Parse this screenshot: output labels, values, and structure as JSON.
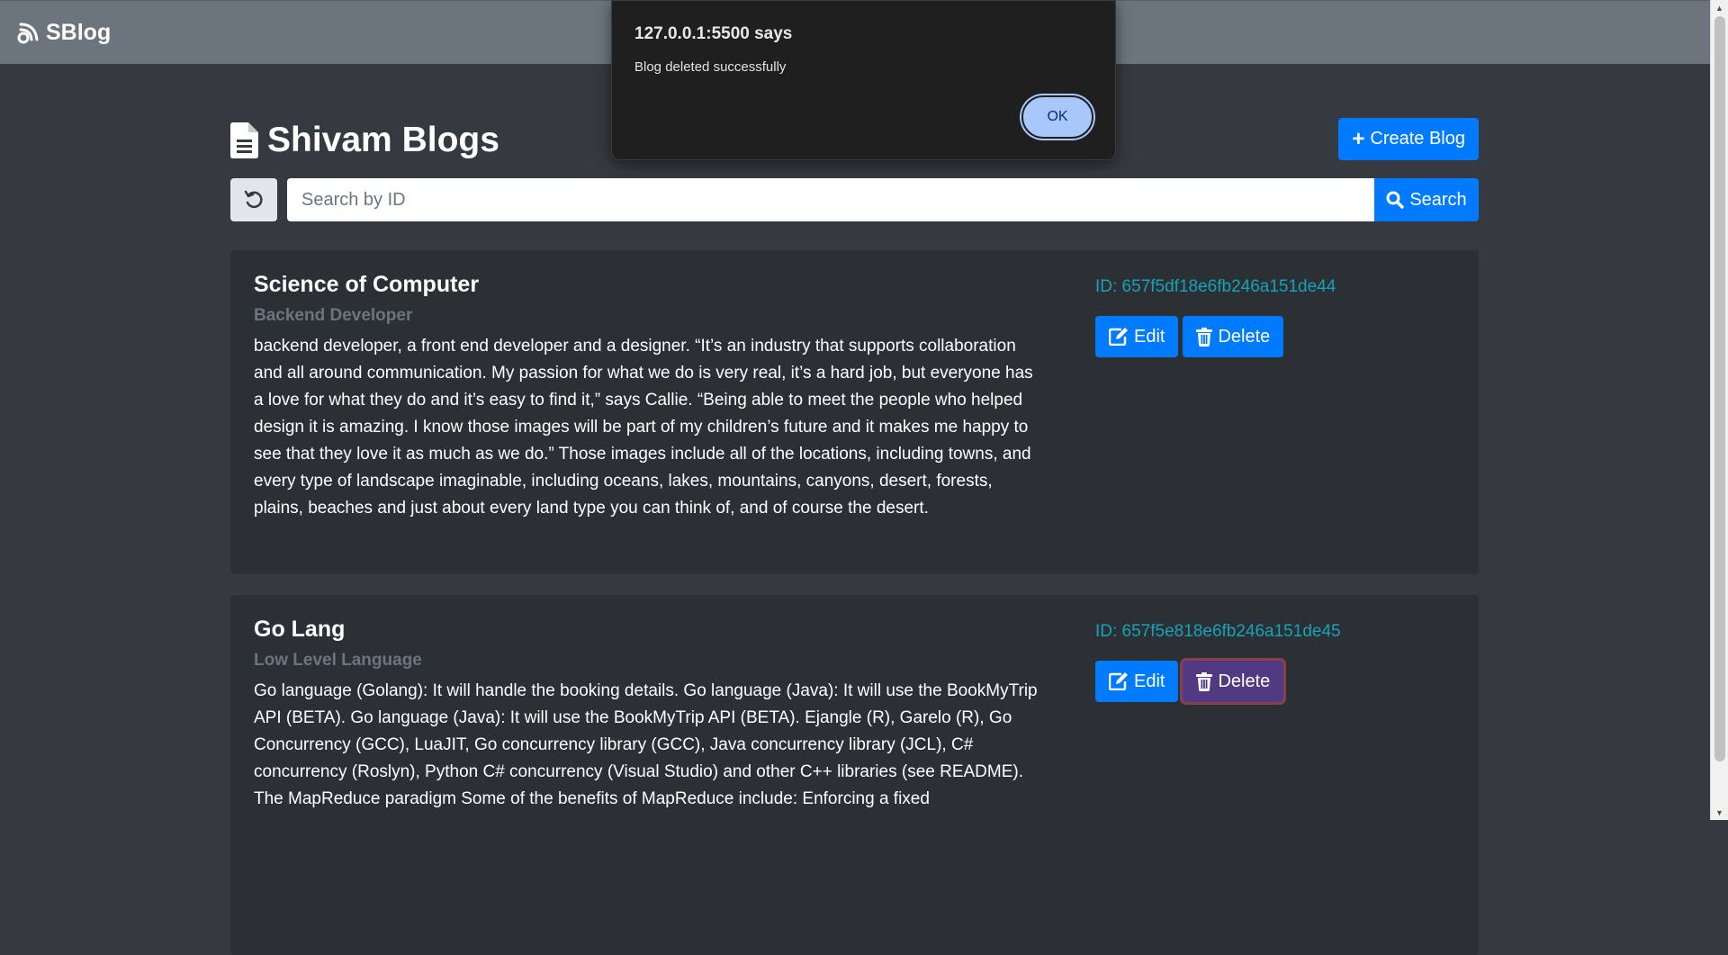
{
  "navbar": {
    "brand": "SBlog"
  },
  "page": {
    "title": "Shivam Blogs",
    "create_button": "Create Blog",
    "search": {
      "placeholder": "Search by ID",
      "value": "",
      "button": "Search"
    }
  },
  "blogs": [
    {
      "title": "Science of Computer",
      "subtitle": "Backend Developer",
      "body": "backend developer, a front end developer and a designer. “It’s an industry that supports collaboration and all around communication. My passion for what we do is very real, it’s a hard job, but everyone has a love for what they do and it’s easy to find it,” says Callie. “Being able to meet the people who helped design it is amazing. I know those images will be part of my children’s future and it makes me happy to see that they love it as much as we do.” Those images include all of the locations, including towns, and every type of landscape imaginable, including oceans, lakes, mountains, canyons, desert, forests, plains, beaches and just about every land type you can think of, and of course the desert.",
      "id_text": "ID: 657f5df18e6fb246a151de44",
      "edit": "Edit",
      "delete": "Delete"
    },
    {
      "title": "Go Lang",
      "subtitle": "Low Level Language",
      "body": "Go language (Golang): It will handle the booking details. Go language (Java): It will use the BookMyTrip API (BETA). Go language (Java): It will use the BookMyTrip API (BETA). Ejangle (R), Garelo (R), Go Concurrency (GCC), LuaJIT, Go concurrency library (GCC), Java concurrency library (JCL), C# concurrency (Roslyn), Python C# concurrency (Visual Studio) and other C++ libraries (see README). The MapReduce paradigm Some of the benefits of MapReduce include: Enforcing a fixed",
      "id_text": "ID: 657f5e818e6fb246a151de45",
      "edit": "Edit",
      "delete": "Delete"
    }
  ],
  "dialog": {
    "title": "127.0.0.1:5500 says",
    "message": "Blog deleted successfully",
    "ok": "OK"
  },
  "colors": {
    "navbar": "#6c757d",
    "background": "#343a40",
    "card": "#2b3035",
    "primary": "#007bff",
    "info": "#17a2b8"
  }
}
